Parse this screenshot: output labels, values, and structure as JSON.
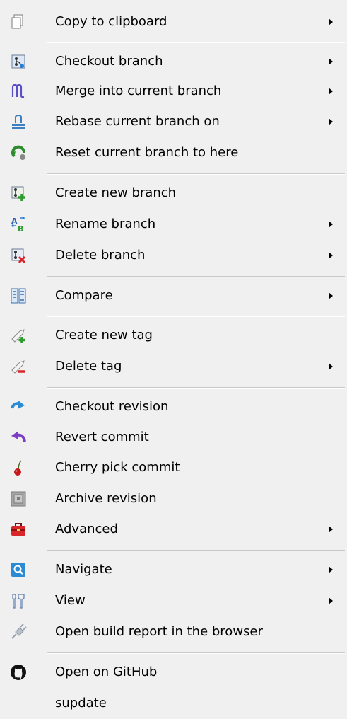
{
  "menu": {
    "items": [
      {
        "label": "Copy to clipboard",
        "icon": "copy-icon",
        "submenu": true
      },
      {
        "label": "Checkout branch",
        "icon": "checkout-branch-icon",
        "submenu": true
      },
      {
        "label": "Merge into current branch",
        "icon": "merge-icon",
        "submenu": true
      },
      {
        "label": "Rebase current branch on",
        "icon": "rebase-icon",
        "submenu": true
      },
      {
        "label": "Reset current branch to here",
        "icon": "reset-icon",
        "submenu": false
      },
      {
        "label": "Create new branch",
        "icon": "create-branch-icon",
        "submenu": false
      },
      {
        "label": "Rename branch",
        "icon": "rename-branch-icon",
        "submenu": true
      },
      {
        "label": "Delete branch",
        "icon": "delete-branch-icon",
        "submenu": true
      },
      {
        "label": "Compare",
        "icon": "compare-icon",
        "submenu": true
      },
      {
        "label": "Create new tag",
        "icon": "create-tag-icon",
        "submenu": false
      },
      {
        "label": "Delete tag",
        "icon": "delete-tag-icon",
        "submenu": true
      },
      {
        "label": "Checkout revision",
        "icon": "checkout-revision-icon",
        "submenu": false
      },
      {
        "label": "Revert commit",
        "icon": "revert-commit-icon",
        "submenu": false
      },
      {
        "label": "Cherry pick commit",
        "icon": "cherry-icon",
        "submenu": false
      },
      {
        "label": "Archive revision",
        "icon": "archive-icon",
        "submenu": false
      },
      {
        "label": "Advanced",
        "icon": "toolbox-icon",
        "submenu": true
      },
      {
        "label": "Navigate",
        "icon": "navigate-icon",
        "submenu": true
      },
      {
        "label": "View",
        "icon": "view-icon",
        "submenu": true
      },
      {
        "label": "Open build report in the browser",
        "icon": "build-report-icon",
        "submenu": false
      },
      {
        "label": "Open on GitHub",
        "icon": "github-icon",
        "submenu": false
      },
      {
        "label": "supdate",
        "icon": "",
        "submenu": false
      }
    ]
  },
  "colors": {
    "background": "#f0f0f0",
    "separator": "#c8c8c8",
    "accent_blue": "#2a7fd4",
    "accent_green": "#2e9b2e",
    "accent_red": "#d8262b",
    "accent_purple": "#7b3fc4"
  }
}
